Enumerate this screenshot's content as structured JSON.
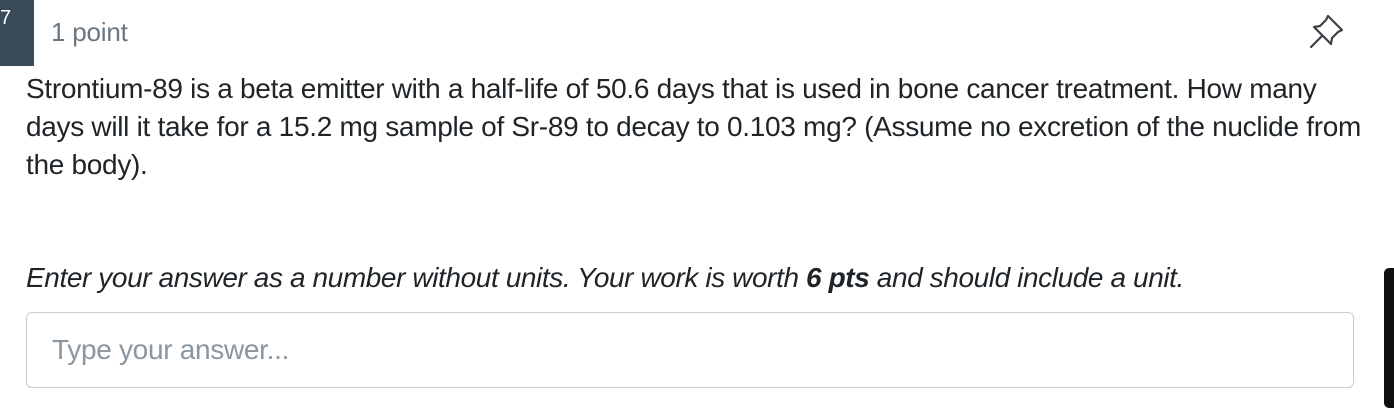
{
  "question_header": {
    "number": "7",
    "points_label": "1 point",
    "pin_icon": "pin-icon"
  },
  "question": {
    "text": "Strontium-89 is a beta emitter with a half-life of 50.6 days that is used in bone cancer treatment. How many days will it take for a 15.2 mg sample of Sr-89 to decay to 0.103 mg? (Assume no excretion of the nuclide from the body)."
  },
  "instruction": {
    "part1": "Enter your answer as a number without units. Your work is worth ",
    "bold": "6 pts",
    "part2": " and should include a unit."
  },
  "answer": {
    "placeholder": "Type your answer...",
    "value": ""
  },
  "colors": {
    "tab_background": "#394b58",
    "points_text": "#6b7780",
    "body_text": "#1f2428",
    "input_border": "#c7cdd1",
    "placeholder": "#8b969e"
  }
}
